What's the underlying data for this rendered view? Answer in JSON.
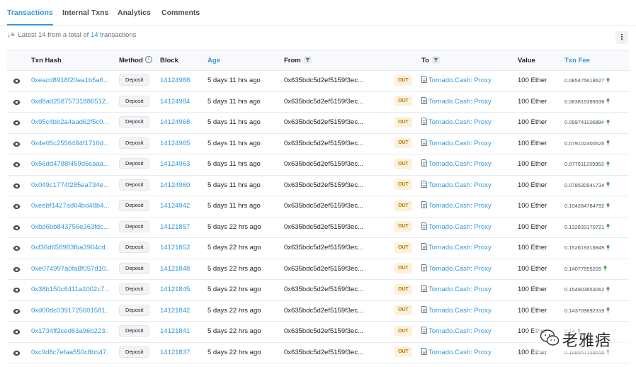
{
  "tabs": [
    {
      "label": "Transactions",
      "active": true
    },
    {
      "label": "Internal Txns",
      "active": false
    },
    {
      "label": "Analytics",
      "active": false
    },
    {
      "label": "Comments",
      "active": false
    }
  ],
  "summary": {
    "prefix": "Latest 14 from a total of",
    "count": "14",
    "suffix": "transactions",
    "sort_icon": "sort-descending-icon"
  },
  "more_button": {
    "icon": "more-vertical-icon",
    "label": "⋮"
  },
  "table": {
    "headers": {
      "txn_hash": "Txn Hash",
      "method": "Method",
      "block": "Block",
      "age": "Age",
      "from": "From",
      "to": "To",
      "value": "Value",
      "txn_fee": "Txn Fee"
    },
    "accent_color": "#3498db",
    "rows": [
      {
        "hash": "0xeacd8918f20ea1b5a6...",
        "method": "Deposit",
        "block": "14124988",
        "age": "5 days 11 hrs ago",
        "from": "0x635bdc5d2ef5159f3ec...",
        "direction": "OUT",
        "to": "Tornado.Cash: Proxy",
        "value": "100 Ether",
        "fee": "0.085475618627"
      },
      {
        "hash": "0xd8ad25875731886512...",
        "method": "Deposit",
        "block": "14124984",
        "age": "5 days 11 hrs ago",
        "from": "0x635bdc5d2ef5159f3ec...",
        "direction": "OUT",
        "to": "Tornado.Cash: Proxy",
        "value": "100 Ether",
        "fee": "0.083815399338"
      },
      {
        "hash": "0x95c4bb2a4aad62f5c0...",
        "method": "Deposit",
        "block": "14124968",
        "age": "5 days 11 hrs ago",
        "from": "0x635bdc5d2ef5159f3ec...",
        "direction": "OUT",
        "to": "Tornado.Cash: Proxy",
        "value": "100 Ether",
        "fee": "0.099741136884"
      },
      {
        "hash": "0x4e05c2556484f1710d...",
        "method": "Deposit",
        "block": "14124965",
        "age": "5 days 11 hrs ago",
        "from": "0x635bdc5d2ef5159f3ec...",
        "direction": "OUT",
        "to": "Tornado.Cash: Proxy",
        "value": "100 Ether",
        "fee": "0.079102300525"
      },
      {
        "hash": "0x56dd4788f459d6caaa...",
        "method": "Deposit",
        "block": "14124963",
        "age": "5 days 11 hrs ago",
        "from": "0x635bdc5d2ef5159f3ec...",
        "direction": "OUT",
        "to": "Tornado.Cash: Proxy",
        "value": "100 Ether",
        "fee": "0.077911239953"
      },
      {
        "hash": "0x049c1774f285ea734e...",
        "method": "Deposit",
        "block": "14124960",
        "age": "5 days 11 hrs ago",
        "from": "0x635bdc5d2ef5159f3ec...",
        "direction": "OUT",
        "to": "Tornado.Cash: Proxy",
        "value": "100 Ether",
        "fee": "0.078530941734"
      },
      {
        "hash": "0xeebf1427ad04bd48b4...",
        "method": "Deposit",
        "block": "14124942",
        "age": "5 days 11 hrs ago",
        "from": "0x635bdc5d2ef5159f3ec...",
        "direction": "OUT",
        "to": "Tornado.Cash: Proxy",
        "value": "100 Ether",
        "fee": "0.104284784792"
      },
      {
        "hash": "0xbd6bb843756e363fdc...",
        "method": "Deposit",
        "block": "14121857",
        "age": "5 days 22 hrs ago",
        "from": "0x635bdc5d2ef5159f3ec...",
        "direction": "OUT",
        "to": "Tornado.Cash: Proxy",
        "value": "100 Ether",
        "fee": "0.132833170721"
      },
      {
        "hash": "0xf36d658983fba3904cd...",
        "method": "Deposit",
        "block": "14121852",
        "age": "5 days 22 hrs ago",
        "from": "0x635bdc5d2ef5159f3ec...",
        "direction": "OUT",
        "to": "Tornado.Cash: Proxy",
        "value": "100 Ether",
        "fee": "0.152619316849"
      },
      {
        "hash": "0xe074997a0fa8f057d10...",
        "method": "Deposit",
        "block": "14121848",
        "age": "5 days 22 hrs ago",
        "from": "0x635bdc5d2ef5159f3ec...",
        "direction": "OUT",
        "to": "Tornado.Cash: Proxy",
        "value": "100 Ether",
        "fee": "0.14077555209"
      },
      {
        "hash": "0x38b150c6411a1002c7...",
        "method": "Deposit",
        "block": "14121845",
        "age": "5 days 22 hrs ago",
        "from": "0x635bdc5d2ef5159f3ec...",
        "direction": "OUT",
        "to": "Tornado.Cash: Proxy",
        "value": "100 Ether",
        "fee": "0.154903853062"
      },
      {
        "hash": "0xd00dc0391725601581...",
        "method": "Deposit",
        "block": "14121842",
        "age": "5 days 22 hrs ago",
        "from": "0x635bdc5d2ef5159f3ec...",
        "direction": "OUT",
        "to": "Tornado.Cash: Proxy",
        "value": "100 Ether",
        "fee": "0.143709892319"
      },
      {
        "hash": "0x1734ff2ced63a96b223...",
        "method": "Deposit",
        "block": "14121841",
        "age": "5 days 22 hrs ago",
        "from": "0x635bdc5d2ef5159f3ec...",
        "direction": "OUT",
        "to": "Tornado.Cash: Proxy",
        "value": "100 Ether",
        "fee": "0.14"
      },
      {
        "hash": "0xc9d8c7efaa550c8bb47...",
        "method": "Deposit",
        "block": "14121837",
        "age": "5 days 22 hrs ago",
        "from": "0x635bdc5d2ef5159f3ec...",
        "direction": "OUT",
        "to": "Tornado.Cash: Proxy",
        "value": "100 Ether",
        "fee": "0.188957138656"
      }
    ]
  },
  "watermark": {
    "text": "老雅痞",
    "icon": "wechat-icon"
  }
}
